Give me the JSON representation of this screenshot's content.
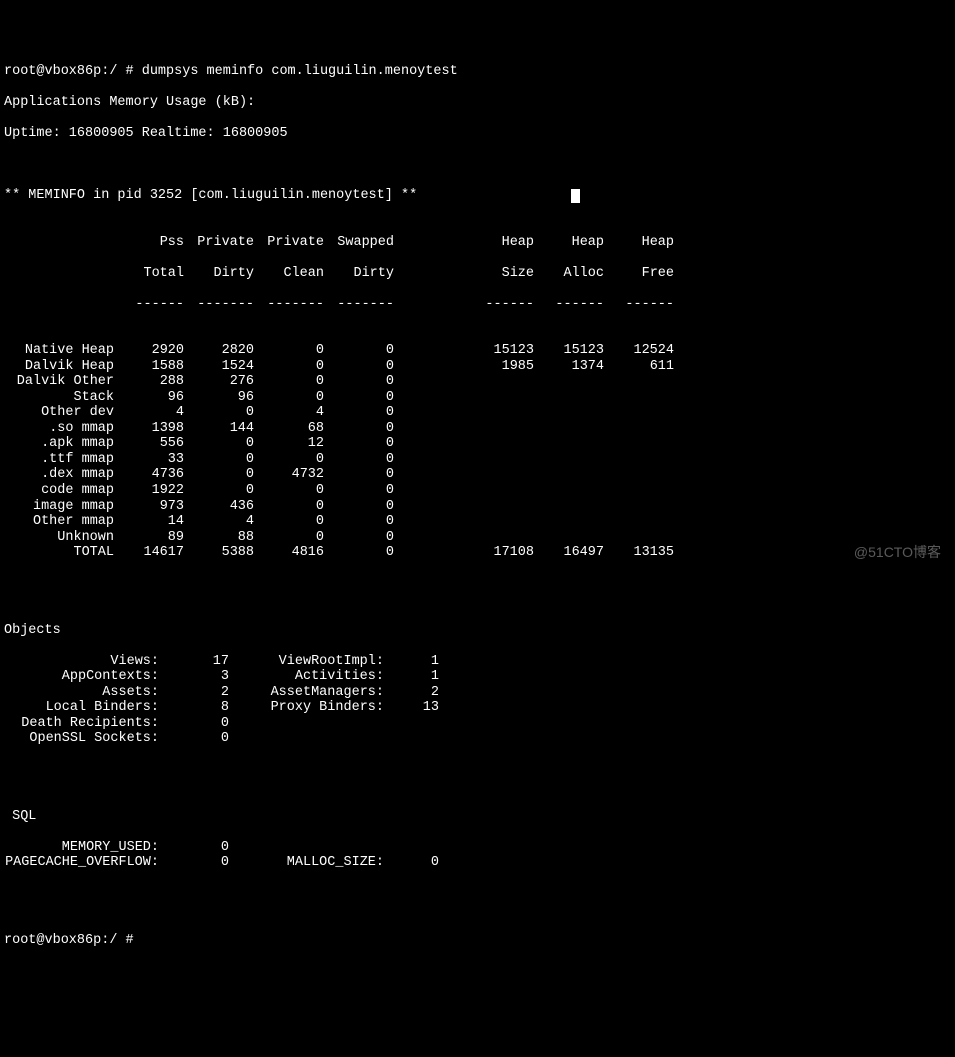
{
  "prompt1": "root@vbox86p:/ # dumpsys meminfo com.liuguilin.menoytest",
  "line_app_usage": "Applications Memory Usage (kB):",
  "line_uptime": "Uptime: 16800905 Realtime: 16800905",
  "meminfo_header": "** MEMINFO in pid 3252 [com.liuguilin.menoytest] **",
  "columns": {
    "h1": [
      "Pss",
      "Private",
      "Private",
      "Swapped",
      "Heap",
      "Heap",
      "Heap"
    ],
    "h2": [
      "Total",
      "Dirty",
      "Clean",
      "Dirty",
      "Size",
      "Alloc",
      "Free"
    ]
  },
  "rows": [
    {
      "name": "Native Heap",
      "pss": "2920",
      "pd": "2820",
      "pc": "0",
      "sw": "0",
      "hs": "15123",
      "ha": "15123",
      "hf": "12524"
    },
    {
      "name": "Dalvik Heap",
      "pss": "1588",
      "pd": "1524",
      "pc": "0",
      "sw": "0",
      "hs": "1985",
      "ha": "1374",
      "hf": "611"
    },
    {
      "name": "Dalvik Other",
      "pss": "288",
      "pd": "276",
      "pc": "0",
      "sw": "0",
      "hs": "",
      "ha": "",
      "hf": ""
    },
    {
      "name": "Stack",
      "pss": "96",
      "pd": "96",
      "pc": "0",
      "sw": "0",
      "hs": "",
      "ha": "",
      "hf": ""
    },
    {
      "name": "Other dev",
      "pss": "4",
      "pd": "0",
      "pc": "4",
      "sw": "0",
      "hs": "",
      "ha": "",
      "hf": ""
    },
    {
      "name": ".so mmap",
      "pss": "1398",
      "pd": "144",
      "pc": "68",
      "sw": "0",
      "hs": "",
      "ha": "",
      "hf": ""
    },
    {
      "name": ".apk mmap",
      "pss": "556",
      "pd": "0",
      "pc": "12",
      "sw": "0",
      "hs": "",
      "ha": "",
      "hf": ""
    },
    {
      "name": ".ttf mmap",
      "pss": "33",
      "pd": "0",
      "pc": "0",
      "sw": "0",
      "hs": "",
      "ha": "",
      "hf": ""
    },
    {
      "name": ".dex mmap",
      "pss": "4736",
      "pd": "0",
      "pc": "4732",
      "sw": "0",
      "hs": "",
      "ha": "",
      "hf": ""
    },
    {
      "name": "code mmap",
      "pss": "1922",
      "pd": "0",
      "pc": "0",
      "sw": "0",
      "hs": "",
      "ha": "",
      "hf": ""
    },
    {
      "name": "image mmap",
      "pss": "973",
      "pd": "436",
      "pc": "0",
      "sw": "0",
      "hs": "",
      "ha": "",
      "hf": ""
    },
    {
      "name": "Other mmap",
      "pss": "14",
      "pd": "4",
      "pc": "0",
      "sw": "0",
      "hs": "",
      "ha": "",
      "hf": ""
    },
    {
      "name": "Unknown",
      "pss": "89",
      "pd": "88",
      "pc": "0",
      "sw": "0",
      "hs": "",
      "ha": "",
      "hf": ""
    },
    {
      "name": "TOTAL",
      "pss": "14617",
      "pd": "5388",
      "pc": "4816",
      "sw": "0",
      "hs": "17108",
      "ha": "16497",
      "hf": "13135"
    }
  ],
  "objects_header": "Objects",
  "objects": [
    {
      "l1": "Views:",
      "v1": "17",
      "l2": "ViewRootImpl:",
      "v2": "1"
    },
    {
      "l1": "AppContexts:",
      "v1": "3",
      "l2": "Activities:",
      "v2": "1"
    },
    {
      "l1": "Assets:",
      "v1": "2",
      "l2": "AssetManagers:",
      "v2": "2"
    },
    {
      "l1": "Local Binders:",
      "v1": "8",
      "l2": "Proxy Binders:",
      "v2": "13"
    },
    {
      "l1": "Death Recipients:",
      "v1": "0",
      "l2": "",
      "v2": ""
    },
    {
      "l1": "OpenSSL Sockets:",
      "v1": "0",
      "l2": "",
      "v2": ""
    }
  ],
  "sql_header": " SQL",
  "sql": [
    {
      "l1": "MEMORY_USED:",
      "v1": "0",
      "l2": "",
      "v2": ""
    },
    {
      "l1": "PAGECACHE_OVERFLOW:",
      "v1": "0",
      "l2": "MALLOC_SIZE:",
      "v2": "0"
    }
  ],
  "prompt2": "root@vbox86p:/ # ",
  "watermark": "@51CTO博客",
  "dash6": "------",
  "dash7": "-------"
}
